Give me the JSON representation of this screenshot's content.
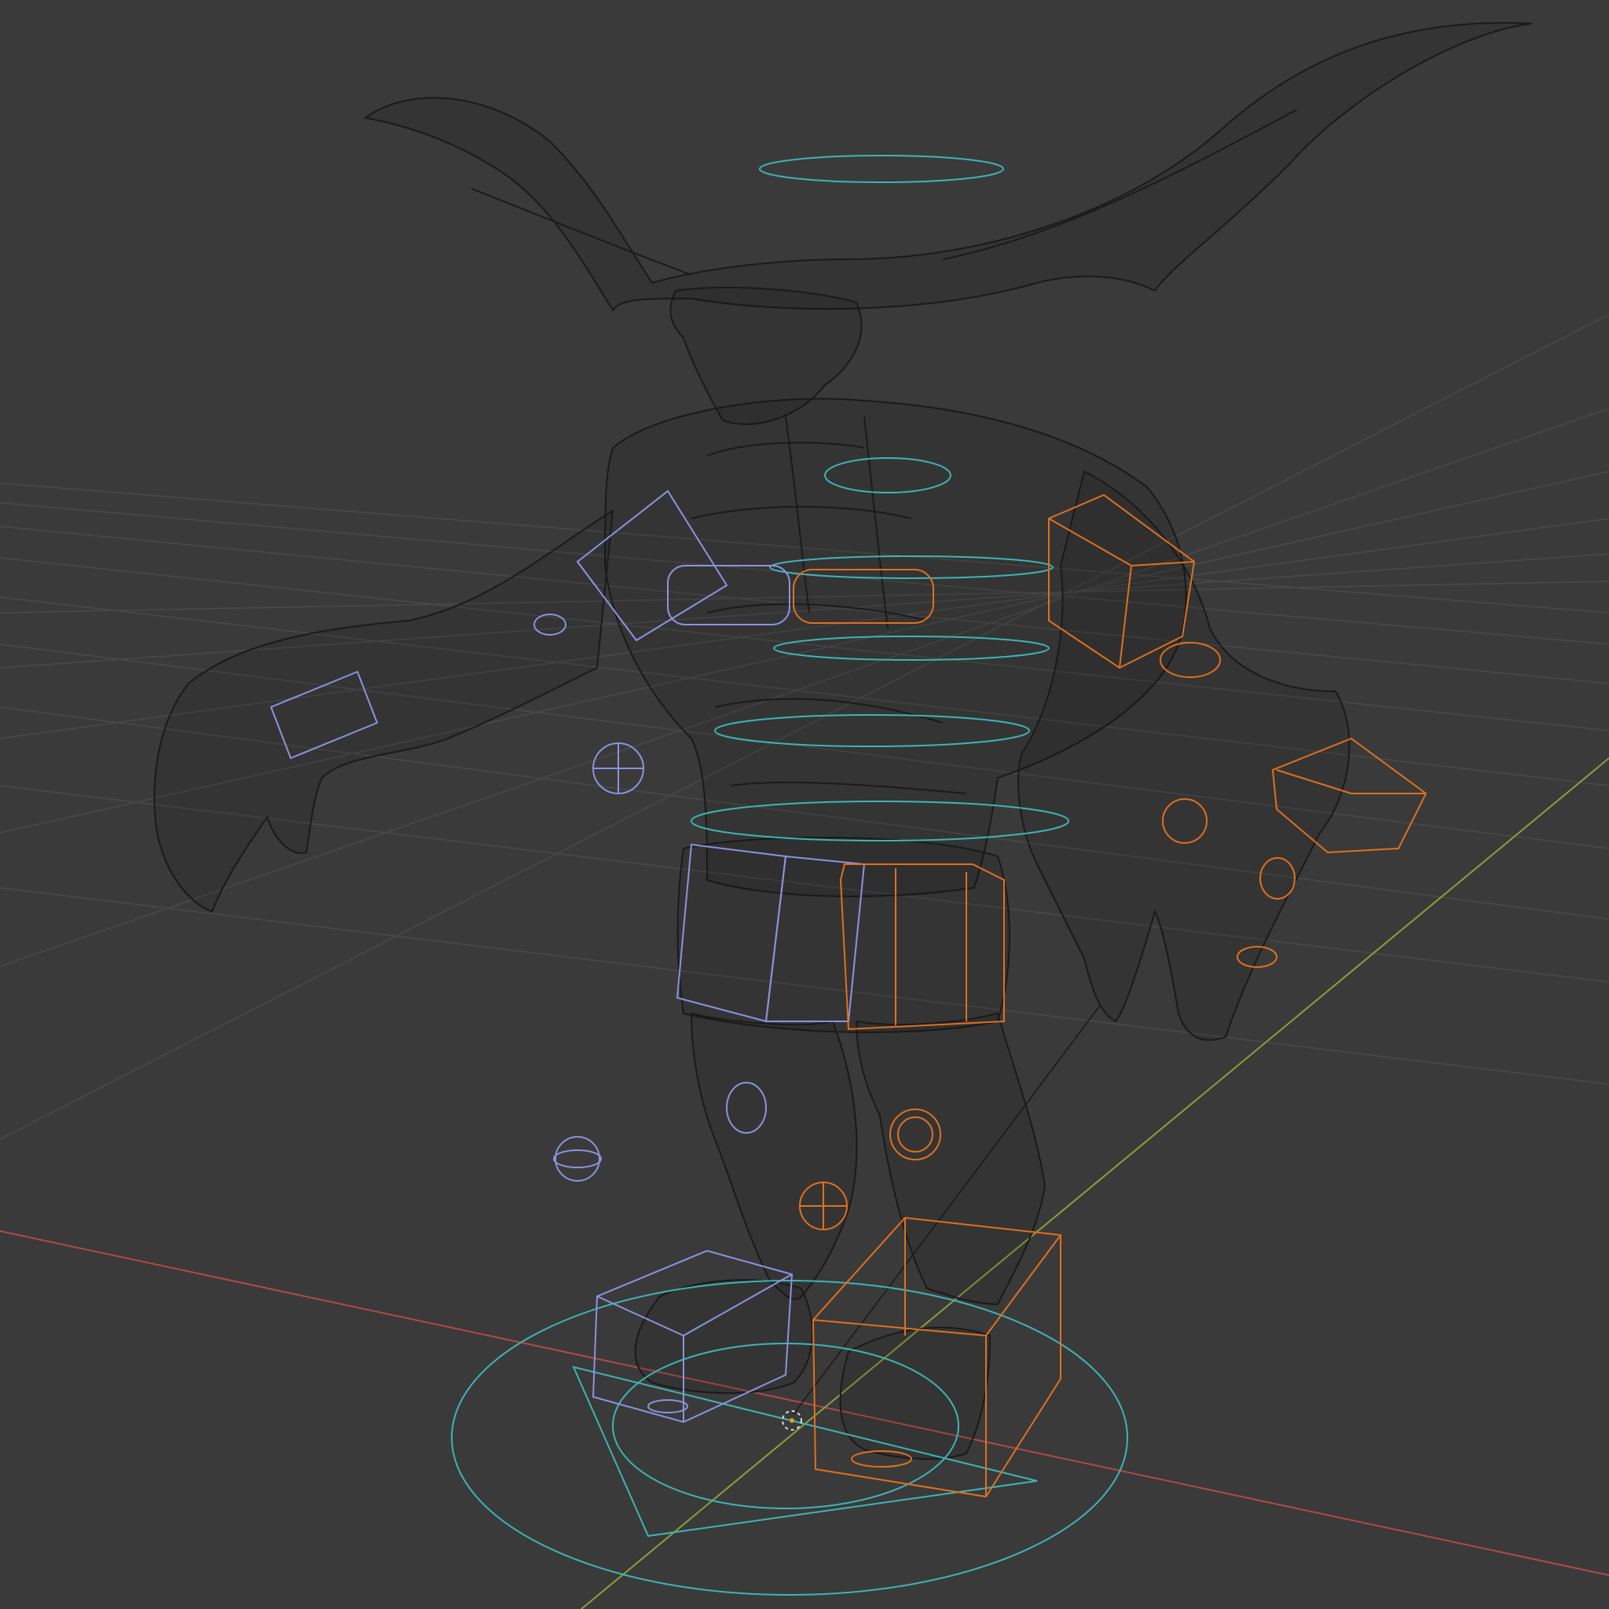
{
  "viewport": {
    "mode": "wireframe",
    "background_color": "#3a3a3a",
    "grid_color": "#4a4a4a",
    "x_axis_color": "#b04a4a",
    "y_axis_color": "#8aa03a",
    "mesh_color": "#1a1a1a"
  },
  "rig": {
    "root_control_color": "#3fb4b4",
    "spine_control_color": "#3fb4b4",
    "left_side_control_color": "#8c93e0",
    "right_side_control_color": "#e0701e",
    "control_shapes": [
      "circle",
      "cube",
      "sphere-gizmo"
    ]
  },
  "scene": {
    "object": "horned-creature-mesh",
    "origin_marker": "3d-cursor-icon"
  }
}
